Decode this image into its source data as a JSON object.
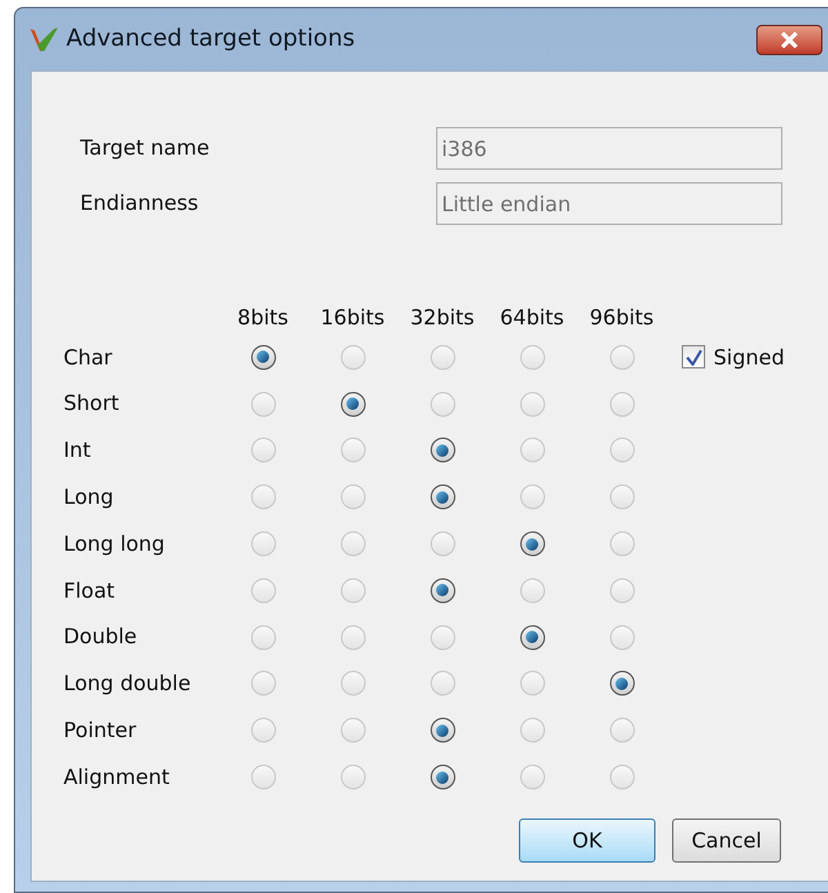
{
  "window": {
    "title": "Advanced target options"
  },
  "fields": [
    {
      "label": "Target name",
      "value": "i386",
      "disabled": true
    },
    {
      "label": "Endianness",
      "value": "Little endian",
      "disabled": true
    }
  ],
  "columns": [
    "8bits",
    "16bits",
    "32bits",
    "64bits",
    "96bits"
  ],
  "rows": [
    {
      "label": "Char",
      "options": [
        {
          "selected": true
        },
        {
          "selected": false
        },
        {
          "selected": false
        },
        {
          "selected": false
        },
        {
          "selected": false
        }
      ],
      "checkbox": {
        "label": "Signed",
        "checked": true
      }
    },
    {
      "label": "Short",
      "options": [
        {
          "selected": false
        },
        {
          "selected": true
        },
        {
          "selected": false
        },
        {
          "selected": false
        },
        {
          "selected": false
        }
      ]
    },
    {
      "label": "Int",
      "options": [
        {
          "selected": false
        },
        {
          "selected": false
        },
        {
          "selected": true
        },
        {
          "selected": false
        },
        {
          "selected": false
        }
      ]
    },
    {
      "label": "Long",
      "options": [
        {
          "selected": false
        },
        {
          "selected": false
        },
        {
          "selected": true
        },
        {
          "selected": false
        },
        {
          "selected": false
        }
      ]
    },
    {
      "label": "Long long",
      "options": [
        {
          "selected": false
        },
        {
          "selected": false
        },
        {
          "selected": false
        },
        {
          "selected": true
        },
        {
          "selected": false
        }
      ]
    },
    {
      "label": "Float",
      "options": [
        {
          "selected": false
        },
        {
          "selected": false
        },
        {
          "selected": true
        },
        {
          "selected": false
        },
        {
          "selected": false
        }
      ]
    },
    {
      "label": "Double",
      "options": [
        {
          "selected": false
        },
        {
          "selected": false
        },
        {
          "selected": false
        },
        {
          "selected": true
        },
        {
          "selected": false
        }
      ]
    },
    {
      "label": "Long double",
      "options": [
        {
          "selected": false
        },
        {
          "selected": false
        },
        {
          "selected": false
        },
        {
          "selected": false
        },
        {
          "selected": true
        }
      ]
    },
    {
      "label": "Pointer",
      "options": [
        {
          "selected": false
        },
        {
          "selected": false
        },
        {
          "selected": true
        },
        {
          "selected": false
        },
        {
          "selected": false
        }
      ]
    },
    {
      "label": "Alignment",
      "options": [
        {
          "selected": false
        },
        {
          "selected": false
        },
        {
          "selected": true
        },
        {
          "selected": false
        },
        {
          "selected": false
        }
      ]
    }
  ],
  "buttons": [
    {
      "label": "OK",
      "kind": "default"
    },
    {
      "label": "Cancel",
      "kind": "normal"
    }
  ]
}
